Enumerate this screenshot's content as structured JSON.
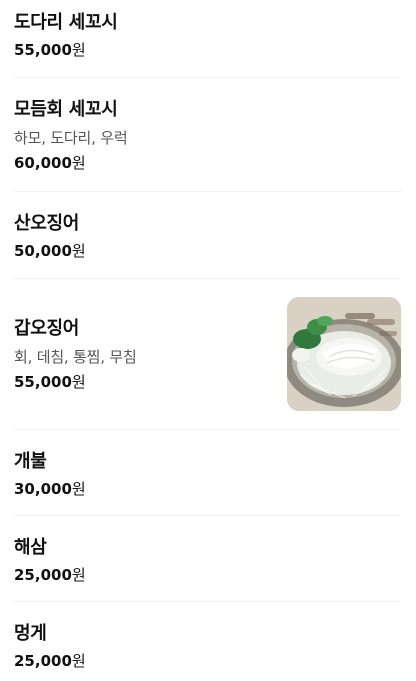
{
  "menu": {
    "items": [
      {
        "name": "도다리 세꼬시",
        "description": "",
        "price": "55,000",
        "unit": "원"
      },
      {
        "name": "모듬회 세꼬시",
        "description": "하모, 도다리, 우럭",
        "price": "60,000",
        "unit": "원"
      },
      {
        "name": "산오징어",
        "description": "",
        "price": "50,000",
        "unit": "원"
      },
      {
        "name": "갑오징어",
        "description": "회, 데침, 통찜, 무침",
        "price": "55,000",
        "unit": "원",
        "photo_icon": "squid-sashimi-photo"
      },
      {
        "name": "개불",
        "description": "",
        "price": "30,000",
        "unit": "원"
      },
      {
        "name": "해삼",
        "description": "",
        "price": "25,000",
        "unit": "원"
      },
      {
        "name": "멍게",
        "description": "",
        "price": "25,000",
        "unit": "원"
      }
    ]
  }
}
